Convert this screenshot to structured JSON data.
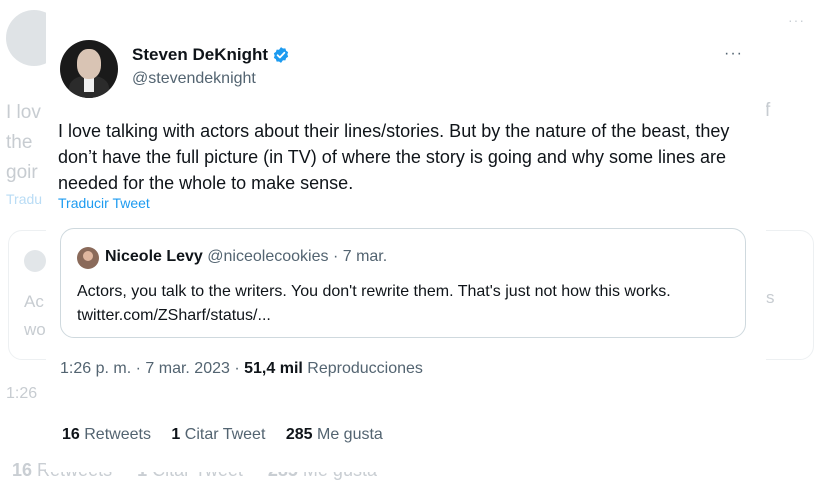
{
  "tweet": {
    "author": {
      "name": "Steven DeKnight",
      "handle": "@stevendeknight",
      "verified": true
    },
    "text": "I love talking with actors about their lines/stories. But by the nature of the beast, they don’t have the full picture (in TV) of where the story is going and why some lines are needed for the whole to make sense.",
    "translate_label": "Traducir Tweet",
    "more_label": "···",
    "quote": {
      "name": "Niceole Levy",
      "handle": "@niceolecookies",
      "separator": "·",
      "date": "7 mar.",
      "text": "Actors, you talk to the writers. You don't rewrite them. That's just not how this works. twitter.com/ZSharf/status/..."
    },
    "meta": {
      "time": "1:26 p. m.",
      "separator1": "·",
      "date": "7 mar. 2023",
      "separator2": "·",
      "views_count": "51,4 mil",
      "views_label": "Reproducciones"
    },
    "stats": {
      "retweets_count": "16",
      "retweets_label": "Retweets",
      "quotes_count": "1",
      "quotes_label": "Citar Tweet",
      "likes_count": "285",
      "likes_label": "Me gusta"
    }
  },
  "background": {
    "text_lines": [
      "I lov",
      "the",
      "goir"
    ],
    "f": "f",
    "translate_fragment": "Tradu",
    "card_lines": [
      "Ac",
      "wo"
    ],
    "card_s": "s",
    "time_fragment": "1:26",
    "stats_numbers": [
      "16",
      "1",
      "285"
    ],
    "stats_labels": [
      "Retweets",
      "Citar Tweet",
      "Me gusta"
    ],
    "dots": "···"
  },
  "colors": {
    "accent": "#1d9bf0",
    "text": "#0f1419",
    "secondary": "#536471",
    "border": "#cfd9de"
  }
}
